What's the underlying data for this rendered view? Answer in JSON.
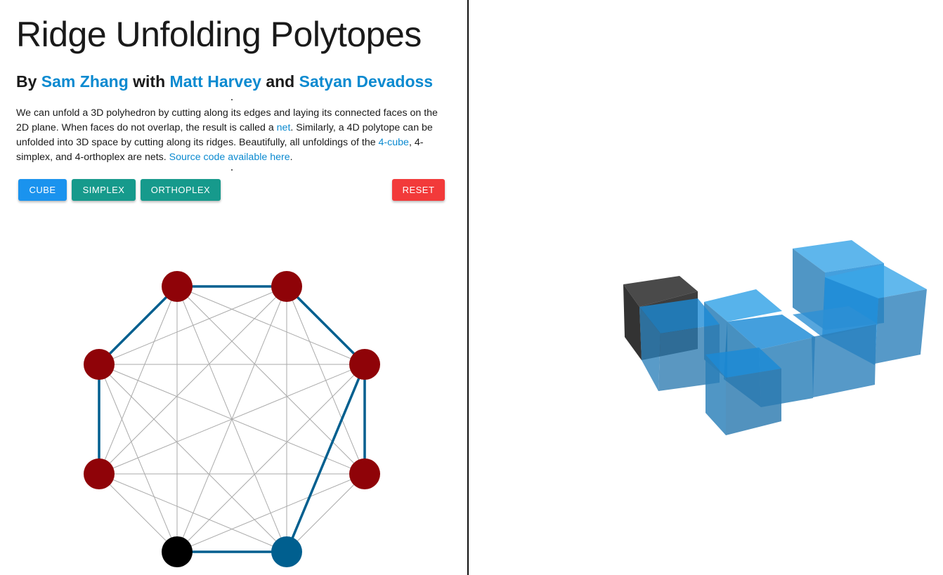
{
  "header": {
    "title": "Ridge Unfolding Polytopes",
    "by": "By",
    "author1": "Sam Zhang",
    "with": "with",
    "author2": "Matt Harvey",
    "and": "and",
    "author3": "Satyan Devadoss"
  },
  "intro": {
    "p1": "We can unfold a 3D polyhedron by cutting along its edges and laying its connected faces on the 2D plane. When faces do not overlap, the result is called a ",
    "link_net": "net",
    "p2": ". Similarly, a 4D polytope can be unfolded into 3D space by cutting along its ridges. Beautifully, all unfoldings of the ",
    "link_4cube": "4-cube",
    "p3": ", 4-simplex, and 4-orthoplex are nets. ",
    "link_source": "Source code available here",
    "p4": "."
  },
  "buttons": {
    "cube": "CUBE",
    "simplex": "SIMPLEX",
    "orthoplex": "ORTHOPLEX",
    "reset": "RESET"
  },
  "colors": {
    "cube_button": "#1a93ee",
    "simplex_button": "#169a8c",
    "orthoplex_button": "#169a8c",
    "reset_button": "#f23a3a",
    "link": "#0b8ad0",
    "node_red": "#8f0308",
    "node_black": "#000000",
    "node_blue": "#005f8f",
    "tree_edge": "#005f8f",
    "graph_edge": "#aaaaaa",
    "cube_face": "#1b8ad6",
    "cube_dark": "#454545"
  },
  "graph": {
    "nodes": [
      {
        "id": "top-left",
        "color": "red"
      },
      {
        "id": "top-right",
        "color": "red"
      },
      {
        "id": "upper-left",
        "color": "red"
      },
      {
        "id": "upper-right",
        "color": "red"
      },
      {
        "id": "lower-left",
        "color": "red"
      },
      {
        "id": "lower-right",
        "color": "red"
      },
      {
        "id": "bottom-left",
        "color": "black"
      },
      {
        "id": "bottom-right",
        "color": "blue"
      }
    ],
    "tree_edges": [
      [
        "top-left",
        "top-right"
      ],
      [
        "top-left",
        "upper-left"
      ],
      [
        "upper-left",
        "lower-left"
      ],
      [
        "top-right",
        "upper-right"
      ],
      [
        "upper-right",
        "lower-right"
      ],
      [
        "upper-right",
        "bottom-right"
      ],
      [
        "bottom-left",
        "bottom-right"
      ]
    ]
  }
}
